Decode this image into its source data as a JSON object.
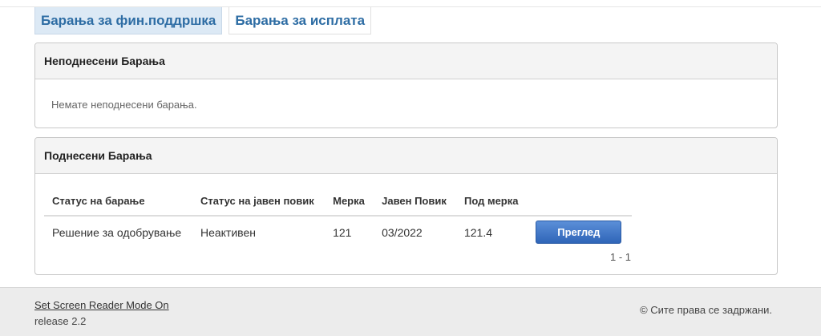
{
  "tabs": [
    {
      "label": "Барања за фин.поддршка",
      "active": true
    },
    {
      "label": "Барања за исплата",
      "active": false
    }
  ],
  "unsubmitted": {
    "title": "Неподнесени Барања",
    "empty_message": "Немате неподнесени барања."
  },
  "submitted": {
    "title": "Поднесени Барања",
    "columns": [
      "Статус на барање",
      "Статус на јавен повик",
      "Мерка",
      "Јавен Повик",
      "Под мерка"
    ],
    "rows": [
      {
        "status": "Решение за одобрување",
        "call_status": "Неактивен",
        "measure": "121",
        "public_call": "03/2022",
        "sub_measure": "121.4",
        "action_label": "Преглед"
      }
    ],
    "pagination": "1 - 1"
  },
  "footer": {
    "screen_reader_link": "Set Screen Reader Mode On",
    "release": "release 2.2",
    "copyright": "© Сите права се задржани."
  },
  "colors": {
    "accent": "#2e6da4",
    "button": "#2f65b8",
    "active_tab_bg": "#dce9f5"
  }
}
